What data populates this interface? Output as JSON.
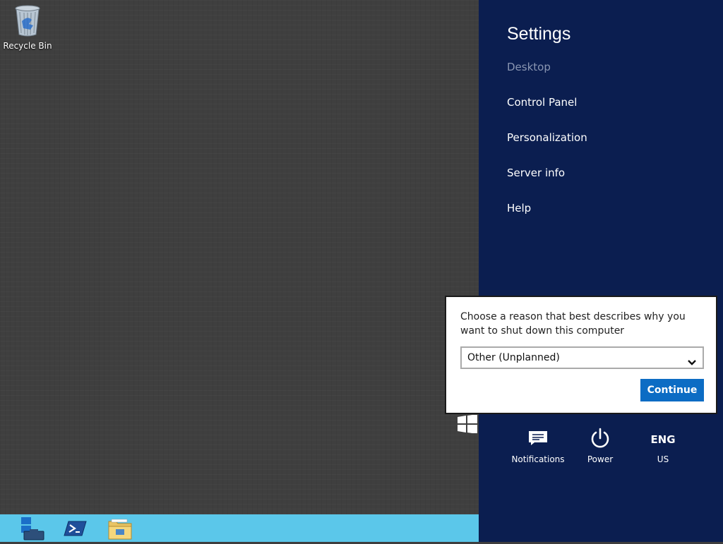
{
  "desktop": {
    "icons": [
      {
        "label": "Recycle Bin",
        "icon": "recycle-bin-icon"
      }
    ]
  },
  "taskbar": {
    "buttons": [
      {
        "icon": "server-manager-icon"
      },
      {
        "icon": "powershell-icon"
      },
      {
        "icon": "file-explorer-icon"
      }
    ],
    "color": "#5bc7ea"
  },
  "charms": {
    "title": "Settings",
    "items": [
      {
        "label": "Desktop",
        "enabled": false
      },
      {
        "label": "Control Panel",
        "enabled": true
      },
      {
        "label": "Personalization",
        "enabled": true
      },
      {
        "label": "Server info",
        "enabled": true
      },
      {
        "label": "Help",
        "enabled": true
      }
    ],
    "bottom": {
      "notifications": {
        "label": "Notifications",
        "icon": "notifications-icon"
      },
      "power": {
        "label": "Power",
        "icon": "power-icon"
      },
      "language": {
        "top": "ENG",
        "bottom": "US"
      }
    },
    "color": "#0b1e50"
  },
  "shutdown_dialog": {
    "prompt": "Choose a reason that best describes why you want to shut down this computer",
    "selected_reason": "Other (Unplanned)",
    "continue_label": "Continue",
    "accent": "#0c6cc4"
  }
}
